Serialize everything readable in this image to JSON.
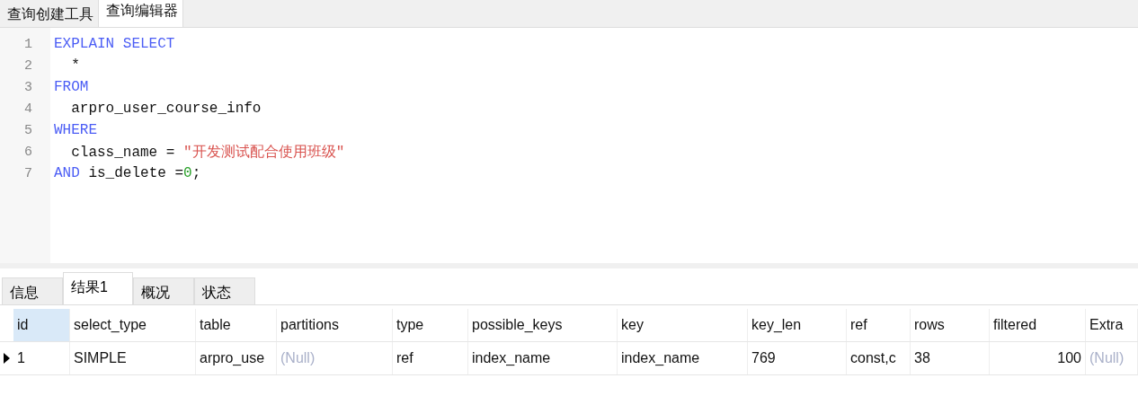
{
  "top_tabs": [
    {
      "label": "查询创建工具",
      "selected": false
    },
    {
      "label": "查询编辑器",
      "selected": true
    }
  ],
  "editor": {
    "lines": [
      {
        "number": "1",
        "tokens": [
          {
            "kind": "keyword",
            "text": "EXPLAIN SELECT"
          }
        ]
      },
      {
        "number": "2",
        "tokens": [
          {
            "kind": "plain",
            "text": "  *"
          }
        ]
      },
      {
        "number": "3",
        "tokens": [
          {
            "kind": "keyword",
            "text": "FROM"
          }
        ]
      },
      {
        "number": "4",
        "tokens": [
          {
            "kind": "plain",
            "text": "  arpro_user_course_info"
          }
        ]
      },
      {
        "number": "5",
        "tokens": [
          {
            "kind": "keyword",
            "text": "WHERE"
          }
        ]
      },
      {
        "number": "6",
        "tokens": [
          {
            "kind": "plain",
            "text": "  class_name = "
          },
          {
            "kind": "string",
            "text": "\"开发测试配合使用班级\""
          }
        ]
      },
      {
        "number": "7",
        "tokens": [
          {
            "kind": "keyword",
            "text": "AND"
          },
          {
            "kind": "plain",
            "text": " is_delete ="
          },
          {
            "kind": "number",
            "text": "0"
          },
          {
            "kind": "plain",
            "text": ";"
          }
        ]
      }
    ]
  },
  "result_tabs": [
    {
      "label": "信息",
      "selected": false
    },
    {
      "label": "结果1",
      "selected": true
    },
    {
      "label": "概况",
      "selected": false
    },
    {
      "label": "状态",
      "selected": false
    }
  ],
  "table": {
    "columns": [
      {
        "label": "id",
        "selected": true
      },
      {
        "label": "select_type",
        "selected": false
      },
      {
        "label": "table",
        "selected": false
      },
      {
        "label": "partitions",
        "selected": false
      },
      {
        "label": "type",
        "selected": false
      },
      {
        "label": "possible_keys",
        "selected": false
      },
      {
        "label": "key",
        "selected": false
      },
      {
        "label": "key_len",
        "selected": false
      },
      {
        "label": "ref",
        "selected": false
      },
      {
        "label": "rows",
        "selected": false
      },
      {
        "label": "filtered",
        "selected": false,
        "numeric": true
      },
      {
        "label": "Extra",
        "selected": false
      }
    ],
    "rows": [
      {
        "current": true,
        "cells": [
          {
            "kind": "value",
            "text": "1"
          },
          {
            "kind": "value",
            "text": "SIMPLE"
          },
          {
            "kind": "value",
            "text": "arpro_use"
          },
          {
            "kind": "null",
            "text": "(Null)"
          },
          {
            "kind": "value",
            "text": "ref"
          },
          {
            "kind": "value",
            "text": "index_name"
          },
          {
            "kind": "value",
            "text": "index_name"
          },
          {
            "kind": "value",
            "text": "769"
          },
          {
            "kind": "value",
            "text": "const,c"
          },
          {
            "kind": "value",
            "text": "38"
          },
          {
            "kind": "value",
            "text": "100"
          },
          {
            "kind": "null",
            "text": "(Null)"
          }
        ]
      }
    ]
  }
}
